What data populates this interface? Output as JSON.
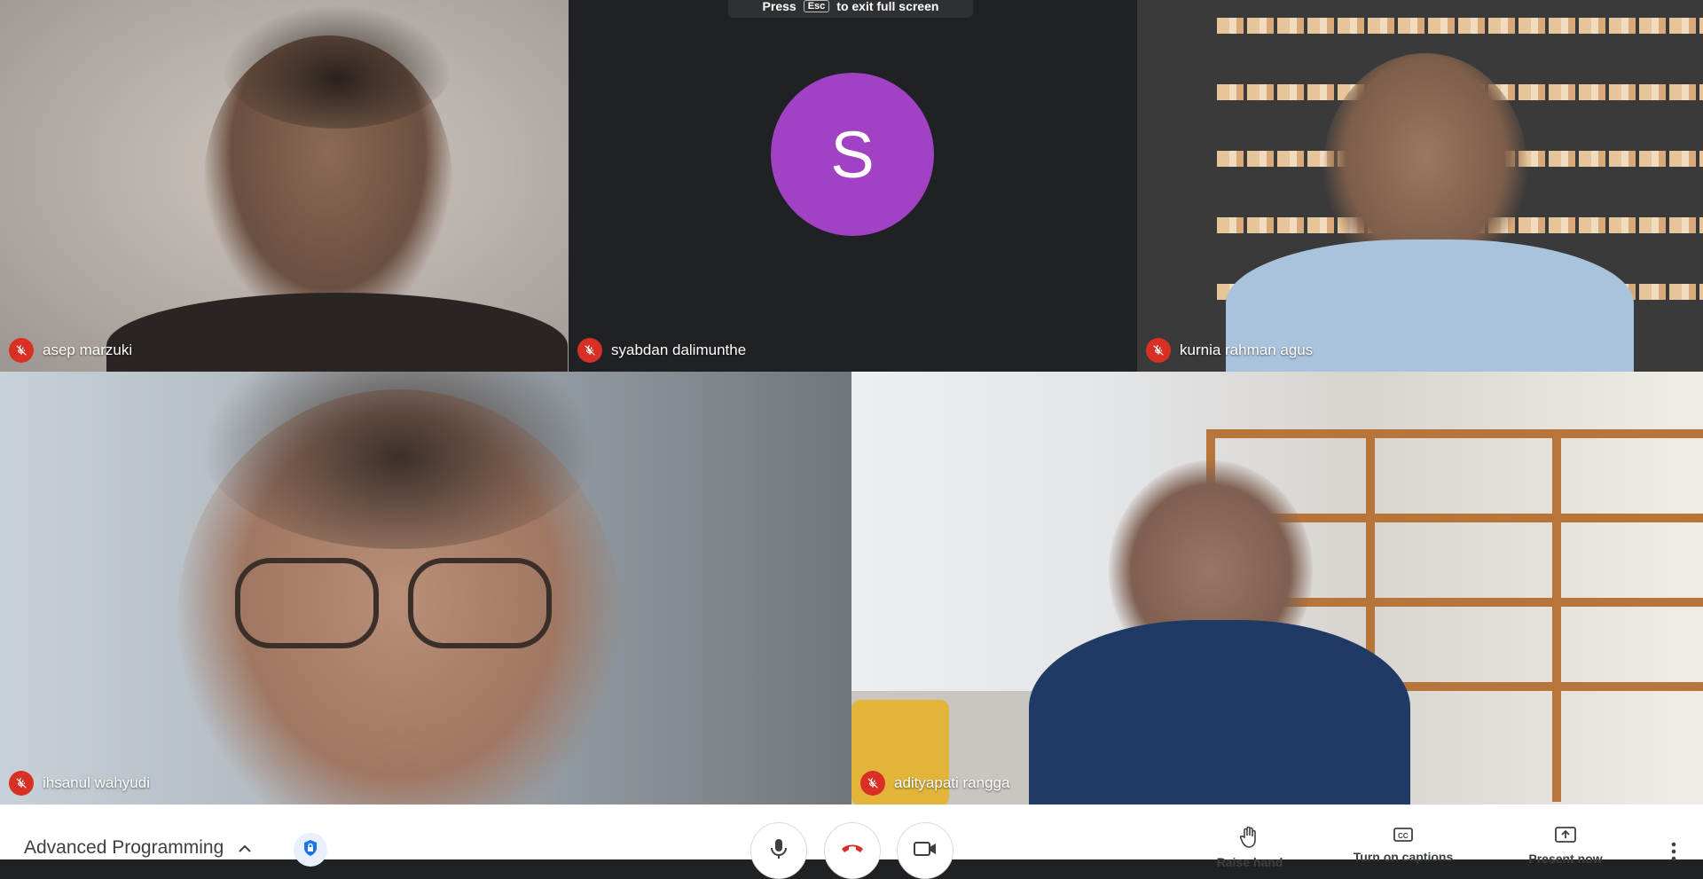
{
  "participants": [
    {
      "name": "asep marzuki",
      "muted": true
    },
    {
      "name": "syabdan dalimunthe",
      "muted": true,
      "avatar_letter": "S",
      "avatar_color": "#a142c4"
    },
    {
      "name": "kurnia rahman agus",
      "muted": true
    },
    {
      "name": "ihsanul wahyudi",
      "muted": true
    },
    {
      "name": "adityapati rangga",
      "muted": true
    }
  ],
  "fullscreen_hint": {
    "before": "Press",
    "key": "Esc",
    "after": "to exit full screen"
  },
  "meeting": {
    "title": "Advanced Programming"
  },
  "controls": {
    "mic_icon": "microphone-icon",
    "hangup_icon": "phone-hangup-icon",
    "camera_icon": "camera-off-icon",
    "raise_hand_label": "Raise hand",
    "captions_label": "Turn on captions",
    "present_label": "Present now"
  },
  "colors": {
    "muted_badge": "#d93025",
    "hangup": "#d93025",
    "accent": "#1a73e8"
  }
}
